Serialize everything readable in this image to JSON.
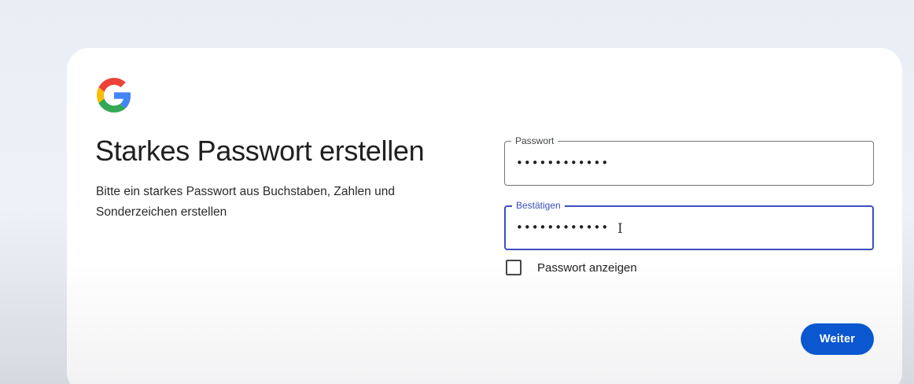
{
  "brand": {
    "logo_icon": "google-g-icon",
    "colors": {
      "blue": "#4285F4",
      "red": "#EA4335",
      "yellow": "#FBBC05",
      "green": "#34A853"
    }
  },
  "main": {
    "title": "Starkes Passwort erstellen",
    "subtitle": "Bitte ein starkes Passwort aus Buchstaben, Zahlen und Sonderzeichen erstellen"
  },
  "form": {
    "password": {
      "label": "Passwort",
      "value": "••••••••••••"
    },
    "confirm": {
      "label": "Bestätigen",
      "value": "••••••••••••",
      "focused": true
    },
    "show_password": {
      "label": "Passwort anzeigen",
      "checked": false
    },
    "next_label": "Weiter"
  },
  "theme": {
    "primary": "#0B57D0",
    "focus_border": "#3C4FBE"
  }
}
